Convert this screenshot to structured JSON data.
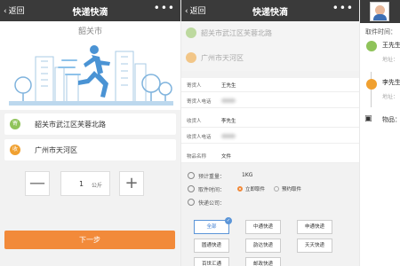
{
  "screen1": {
    "nav": {
      "back": "返回",
      "title": "快递快滴",
      "more": "•••"
    },
    "hero_city": "韶关市",
    "from_address": "韶关市武江区芙蓉北路",
    "to_address": "广州市天河区",
    "from_pin_label": "寄",
    "to_pin_label": "收",
    "quantity": "1",
    "unit": "公斤",
    "minus": "—",
    "plus": "+",
    "next_button": "下一步"
  },
  "screen2": {
    "nav": {
      "back": "返回",
      "title": "快递快滴",
      "more": "•••"
    },
    "from_address": "韶关市武江区芙蓉北路",
    "to_address": "广州市天河区",
    "form": [
      {
        "label": "寄货人",
        "value": "王先生"
      },
      {
        "label": "寄货人电话",
        "value": ""
      },
      {
        "label": "收货人",
        "value": "李先生"
      },
      {
        "label": "收货人电话",
        "value": ""
      },
      {
        "label": "物品名称",
        "value": "文件"
      }
    ],
    "weight_label": "预计重量：",
    "weight_value": "1KG",
    "pickup_label": "取件时间：",
    "pickup_now": "立即取件",
    "pickup_later": "预约取件",
    "company_label": "快递公司：",
    "companies": [
      "全部",
      "中通快递",
      "申通快递",
      "圆通快递",
      "韵达快递",
      "天天快递",
      "百世汇通",
      "邮政快递"
    ],
    "selected_company": "全部"
  },
  "screen3": {
    "pickup_time_label": "取件时间：",
    "sender_name": "王先生",
    "sender_addr_label": "地址：",
    "receiver_name": "李先生",
    "receiver_addr_label": "地址：",
    "goods_label": "物品："
  },
  "colors": {
    "accent": "#f28a3a",
    "nav": "#3a3a3a",
    "green": "#8fc35a",
    "blue": "#5b95d8"
  }
}
